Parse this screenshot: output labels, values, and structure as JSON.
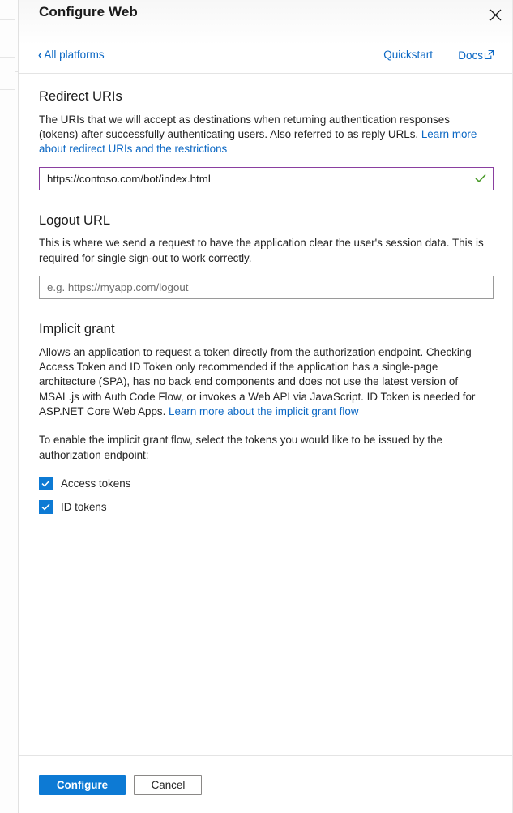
{
  "header": {
    "title": "Configure Web",
    "close_icon": "close-icon",
    "back_link": {
      "label": "All platforms",
      "chevron": "‹"
    },
    "quickstart_label": "Quickstart",
    "docs_label": "Docs",
    "docs_icon": "external-link-icon"
  },
  "sections": {
    "redirect_uris": {
      "title": "Redirect URIs",
      "description_part1": "The URIs that we will accept as destinations when returning authentication responses (tokens) after successfully authenticating users. Also referred to as reply URLs. ",
      "description_link": "Learn more about redirect URIs and the restrictions",
      "input": {
        "value": "https://contoso.com/bot/index.html",
        "placeholder": "",
        "validation_icon": "checkmark-icon",
        "validation_color": "#4a9a2a",
        "border_color": "#8a3fa0"
      }
    },
    "logout_url": {
      "title": "Logout URL",
      "description": "This is where we send a request to have the application clear the user's session data. This is required for single sign-out to work correctly.",
      "input": {
        "value": "",
        "placeholder": "e.g. https://myapp.com/logout"
      }
    },
    "implicit_grant": {
      "title": "Implicit grant",
      "description_part1": "Allows an application to request a token directly from the authorization endpoint. Checking Access Token and ID Token only recommended if the application has a single-page architecture (SPA), has no back end components and does not use the latest version of MSAL.js with Auth Code Flow, or invokes a Web API via JavaScript. ID Token is needed for ASP.NET Core Web Apps. ",
      "description_link": "Learn more about the implicit grant flow",
      "instructions": "To enable the implicit grant flow, select the tokens you would like to be issued by the authorization endpoint:",
      "checkboxes": [
        {
          "label": "Access tokens",
          "checked": true
        },
        {
          "label": "ID tokens",
          "checked": true
        }
      ]
    }
  },
  "footer": {
    "configure_label": "Configure",
    "cancel_label": "Cancel"
  },
  "colors": {
    "accent_blue": "#0d7ad4",
    "link_blue": "#0c68c4",
    "validation_purple": "#8a3fa0",
    "validation_green": "#4a9a2a"
  }
}
